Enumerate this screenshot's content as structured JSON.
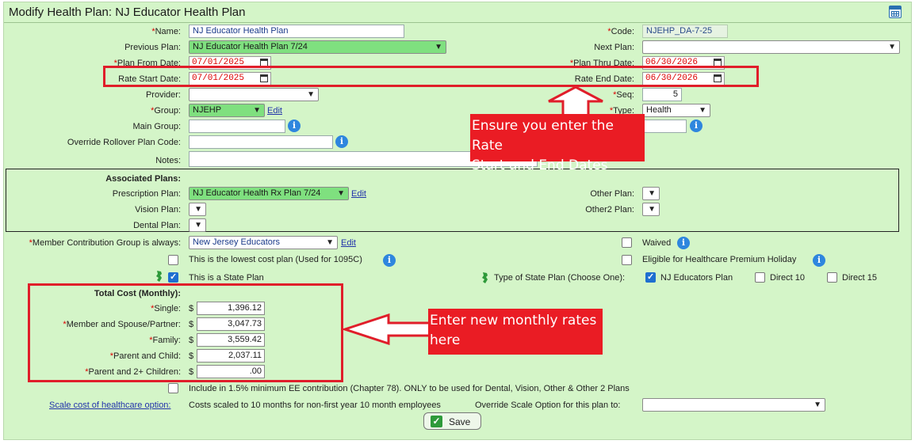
{
  "header": {
    "title": "Modify Health Plan: NJ Educator Health Plan",
    "calendar_icon": "calendar-icon"
  },
  "form": {
    "name_label": "Name:",
    "name_value": "NJ Educator Health Plan",
    "code_label": "Code:",
    "code_value": "NJEHP_DA-7-25",
    "prev_plan_label": "Previous Plan:",
    "prev_plan_value": "NJ Educator Health Plan 7/24",
    "next_plan_label": "Next Plan:",
    "next_plan_value": "",
    "plan_from_label": "Plan From Date:",
    "plan_from_value": "07/01/2025",
    "plan_thru_label": "Plan Thru Date:",
    "plan_thru_value": "06/30/2026",
    "rate_start_label": "Rate Start Date:",
    "rate_start_value": "07/01/2025",
    "rate_end_label": "Rate End Date:",
    "rate_end_value": "06/30/2026",
    "provider_label": "Provider:",
    "provider_value": "",
    "seq_label": "Seq:",
    "seq_value": "5",
    "group_label": "Group:",
    "group_value": "NJEHP",
    "group_edit": "Edit",
    "type_label": "Type:",
    "type_value": "Health",
    "main_group_label": "Main Group:",
    "main_group_value": "",
    "override_rollover_label": "Override Rollover Plan Code:",
    "override_rollover_value": "",
    "notes_label": "Notes:",
    "notes_value": ""
  },
  "associated": {
    "heading": "Associated Plans:",
    "rx_label": "Prescription Plan:",
    "rx_value": "NJ Educator Health Rx Plan 7/24",
    "rx_edit": "Edit",
    "vision_label": "Vision Plan:",
    "dental_label": "Dental Plan:",
    "other_label": "Other Plan:",
    "other2_label": "Other2 Plan:"
  },
  "member": {
    "mcg_label": "Member Contribution Group is always:",
    "mcg_value": "New Jersey Educators",
    "mcg_edit": "Edit",
    "waived_label": "Waived",
    "lowest_cost_label": "This is the lowest cost plan (Used for 1095C)",
    "holiday_label": "Eligible for Healthcare Premium Holiday",
    "state_plan_label": "This is a State Plan",
    "state_plan_type_label": "Type of State Plan (Choose One):",
    "nj_educators_label": "NJ Educators Plan",
    "direct10_label": "Direct 10",
    "direct15_label": "Direct 15"
  },
  "cost": {
    "heading": "Total Cost (Monthly):",
    "currency": "$",
    "single_label": "Single:",
    "single_value": "1,396.12",
    "spouse_label": "Member and Spouse/Partner:",
    "spouse_value": "3,047.73",
    "family_label": "Family:",
    "family_value": "3,559.42",
    "parent_child_label": "Parent and Child:",
    "parent_child_value": "2,037.11",
    "parent_2plus_label": "Parent and 2+ Children:",
    "parent_2plus_value": ".00"
  },
  "footer": {
    "min_ee_label": "Include in 1.5% minimum EE contribution (Chapter 78). ONLY to be used for Dental, Vision, Other & Other 2 Plans",
    "scale_link": "Scale cost of healthcare option:",
    "scale_text": "Costs scaled to 10 months for non-first year 10 month employees",
    "override_scale_label": "Override Scale Option for this plan to:",
    "override_scale_value": "",
    "save_label": "Save"
  },
  "annotations": {
    "rate_callout_line1": "Ensure you enter the Rate",
    "rate_callout_line2": "Start and End Dates",
    "cost_callout_line1": "Enter new monthly rates",
    "cost_callout_line2": "here"
  },
  "colors": {
    "panel": "#d4f5c8",
    "accent_red": "#e01e2a",
    "link_blue": "#2233aa",
    "selected_green": "#7fe07f"
  }
}
